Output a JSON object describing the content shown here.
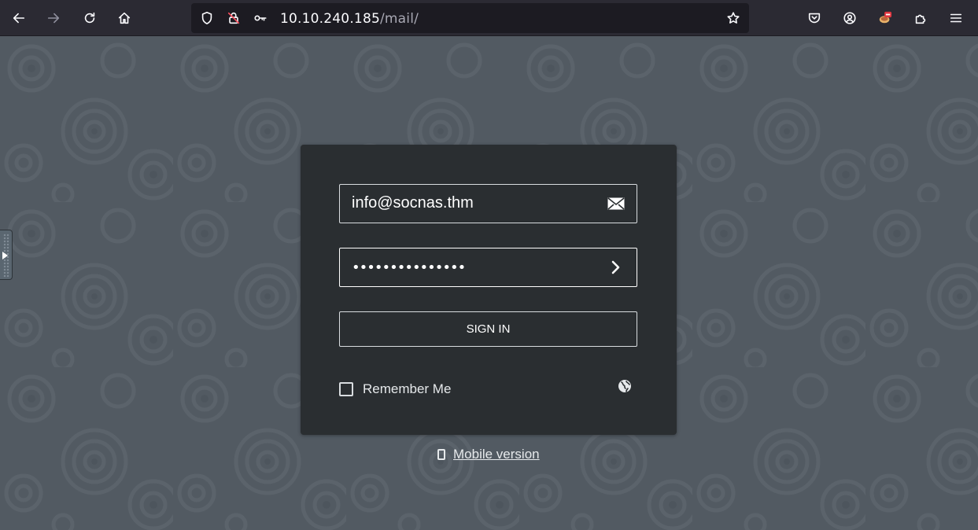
{
  "browser": {
    "url_host": "10.10.240.185",
    "url_path": "/mail/"
  },
  "login": {
    "email_value": "info@socnas.thm",
    "password_masked": "•••••••••••••••",
    "signin_label": "SIGN IN",
    "remember_label": "Remember Me"
  },
  "footer": {
    "mobile_label": "Mobile version"
  },
  "colors": {
    "page_bg": "#525a62",
    "login_box_bg": "#2a2e31",
    "toolbar_bg": "#2b2a33",
    "urlbar_bg": "#1c1b22"
  }
}
